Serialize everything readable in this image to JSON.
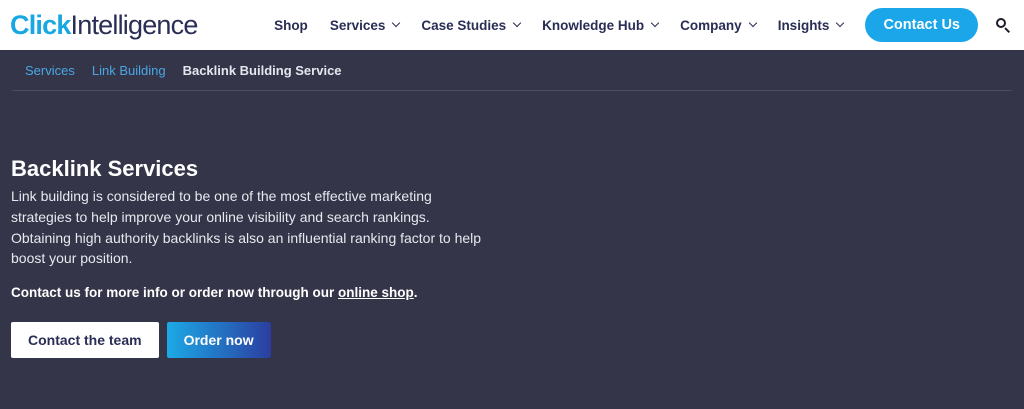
{
  "header": {
    "logo_bold": "Click",
    "logo_light": "Intelligence",
    "nav": [
      {
        "label": "Shop"
      },
      {
        "label": "Services"
      },
      {
        "label": "Case Studies"
      },
      {
        "label": "Knowledge Hub"
      },
      {
        "label": "Company"
      },
      {
        "label": "Insights"
      }
    ],
    "contact_label": "Contact Us",
    "search_icon": "search-icon"
  },
  "breadcrumb": {
    "items": [
      "Services",
      "Link Building"
    ],
    "current": "Backlink Building Service"
  },
  "hero": {
    "title": "Backlink Services",
    "description": "Link building is considered to be one of the most effective marketing strategies to help improve your online visibility and search rankings. Obtaining high authority backlinks is also an influential ranking factor to help boost your position.",
    "cta_text": "Contact us for more info or order now through our ",
    "cta_link": "online shop",
    "cta_end": ".",
    "button_team": "Contact the team",
    "button_order": "Order now"
  },
  "colors": {
    "accent": "#1aa6e8",
    "background": "#343549",
    "nav_text": "#2a2d55"
  }
}
